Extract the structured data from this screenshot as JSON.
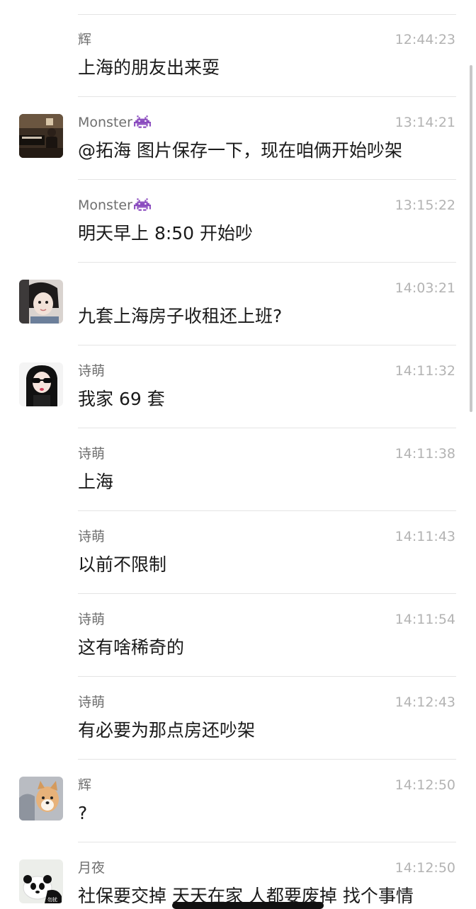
{
  "messages": [
    {
      "sender": "辉",
      "time": "12:44:23",
      "text": "上海的朋友出来耍"
    },
    {
      "sender": "Monster",
      "time": "13:14:21",
      "text": "@拓海 图片保存一下，现在咱俩开始吵架"
    },
    {
      "sender": "Monster",
      "time": "13:15:22",
      "text": "明天早上 8:50 开始吵"
    },
    {
      "sender": "",
      "time": "14:03:21",
      "text": "九套上海房子收租还上班?"
    },
    {
      "sender": "诗萌",
      "time": "14:11:32",
      "text": "我家 69 套"
    },
    {
      "sender": "诗萌",
      "time": "14:11:38",
      "text": "上海"
    },
    {
      "sender": "诗萌",
      "time": "14:11:43",
      "text": "以前不限制"
    },
    {
      "sender": "诗萌",
      "time": "14:11:54",
      "text": "这有啥稀奇的"
    },
    {
      "sender": "诗萌",
      "time": "14:12:43",
      "text": "有必要为那点房还吵架"
    },
    {
      "sender": "辉",
      "time": "14:12:50",
      "text": "?"
    },
    {
      "sender": "月夜",
      "time": "14:12:50",
      "text": "社保要交掉 天天在家 人都要废掉 找个事情"
    }
  ],
  "avatar_labels": {
    "panda": "勿扰"
  },
  "icons": {
    "sender_emoji": "space-invader-icon"
  },
  "colors": {
    "background": "#ffffff",
    "sender": "#6f6f6f",
    "time": "#b3b3b3",
    "text": "#1a1a1a",
    "divider": "#e4e4e4",
    "emoji": "#8a4bbf"
  }
}
